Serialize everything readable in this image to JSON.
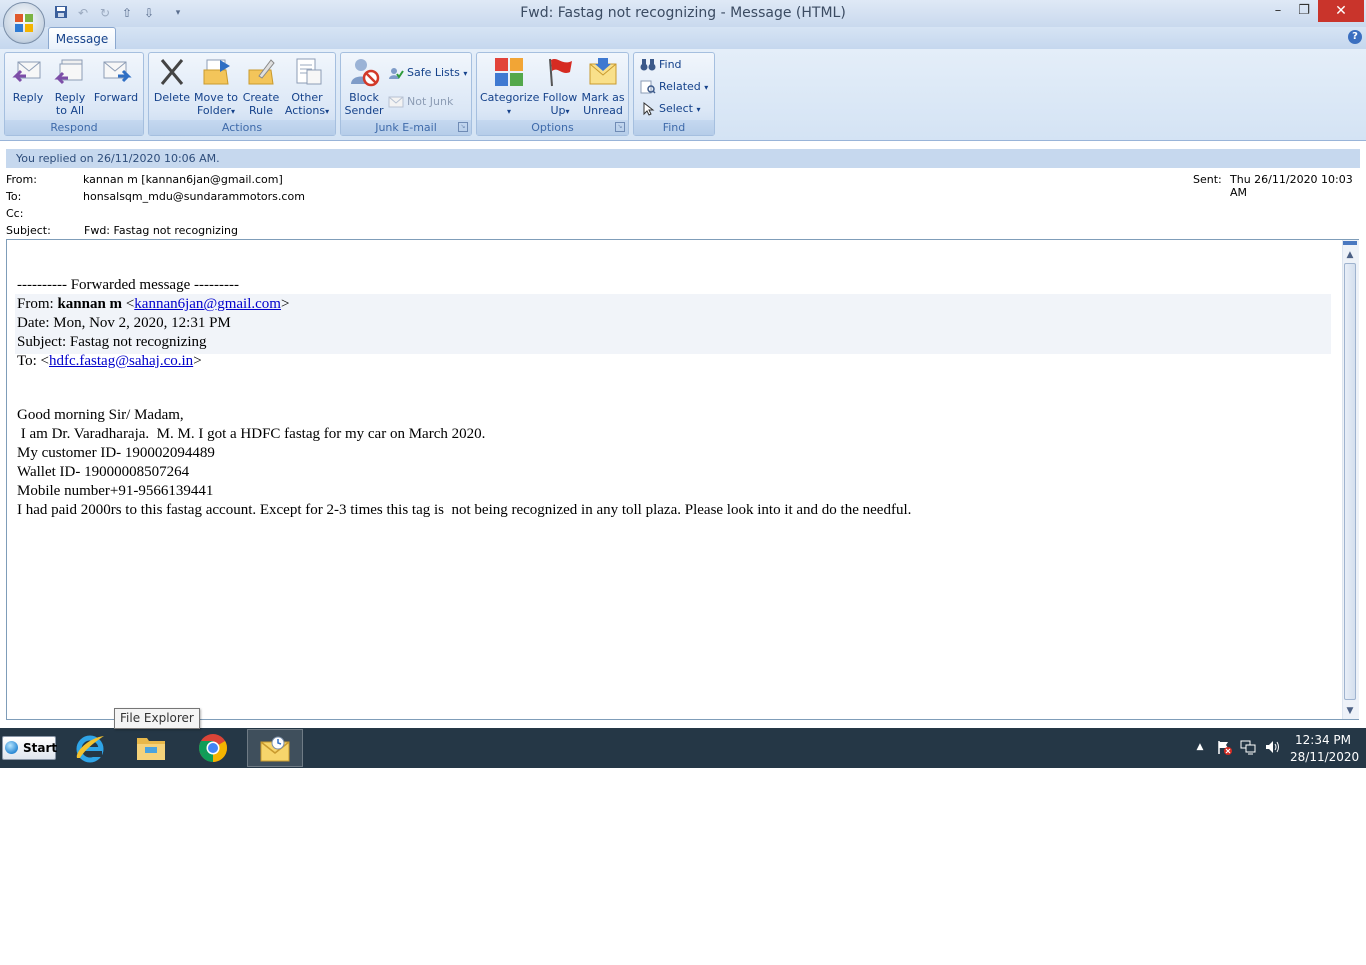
{
  "window": {
    "title": "Fwd: Fastag not recognizing - Message (HTML)",
    "minimize": "–",
    "restore": "❐",
    "close": "✕"
  },
  "tabs": [
    {
      "label": "Message",
      "active": true
    }
  ],
  "ribbon": {
    "respond": {
      "label": "Respond",
      "reply": "Reply",
      "reply_all_1": "Reply",
      "reply_all_2": "to All",
      "forward": "Forward"
    },
    "actions": {
      "label": "Actions",
      "delete": "Delete",
      "move_1": "Move to",
      "move_2": "Folder",
      "create_1": "Create",
      "create_2": "Rule",
      "other_1": "Other",
      "other_2": "Actions"
    },
    "junk": {
      "label": "Junk E-mail",
      "block_1": "Block",
      "block_2": "Sender",
      "safe_lists": "Safe Lists",
      "not_junk": "Not Junk"
    },
    "options": {
      "label": "Options",
      "categorize": "Categorize",
      "follow_1": "Follow",
      "follow_2": "Up",
      "mark_1": "Mark as",
      "mark_2": "Unread"
    },
    "find": {
      "label": "Find",
      "find": "Find",
      "related": "Related",
      "select": "Select"
    }
  },
  "infobar": "You replied on 26/11/2020 10:06 AM.",
  "header": {
    "from_label": "From:",
    "from": "kannan m [kannan6jan@gmail.com]",
    "to_label": "To:",
    "to": "honsalsqm_mdu@sundarammotors.com",
    "cc_label": "Cc:",
    "cc": "",
    "subject_label": "Subject:",
    "subject": "Fwd: Fastag not recognizing",
    "sent_label": "Sent:",
    "sent": "Thu 26/11/2020 10:03 AM"
  },
  "body": {
    "fwd_heading": "---------- Forwarded message ---------",
    "from_label": "From: ",
    "from_name": "kannan m",
    "from_open": " <",
    "from_email": "kannan6jan@gmail.com",
    "from_close": ">",
    "date": "Date: Mon, Nov 2, 2020, 12:31 PM",
    "subject": "Subject: Fastag not recognizing",
    "to_label": "To: <",
    "to_email": "hdfc.fastag@sahaj.co.in",
    "to_close": ">",
    "greeting": "Good morning Sir/ Madam,",
    "line1": " I am Dr. Varadharaja.  M. M. I got a HDFC fastag for my car on March 2020.",
    "line2": "My customer ID- 190002094489",
    "line3": "Wallet ID- 19000008507264",
    "line4": "Mobile number+91-9566139441",
    "line5": "I had paid 2000rs to this fastag account. Except for 2-3 times this tag is  not being recognized in any toll plaza. Please look into it and do the needful."
  },
  "tooltip": "File Explorer",
  "taskbar": {
    "start": "Start",
    "apps": [
      "internet-explorer",
      "file-explorer",
      "chrome",
      "outlook"
    ],
    "time": "12:34 PM",
    "date": "28/11/2020"
  }
}
